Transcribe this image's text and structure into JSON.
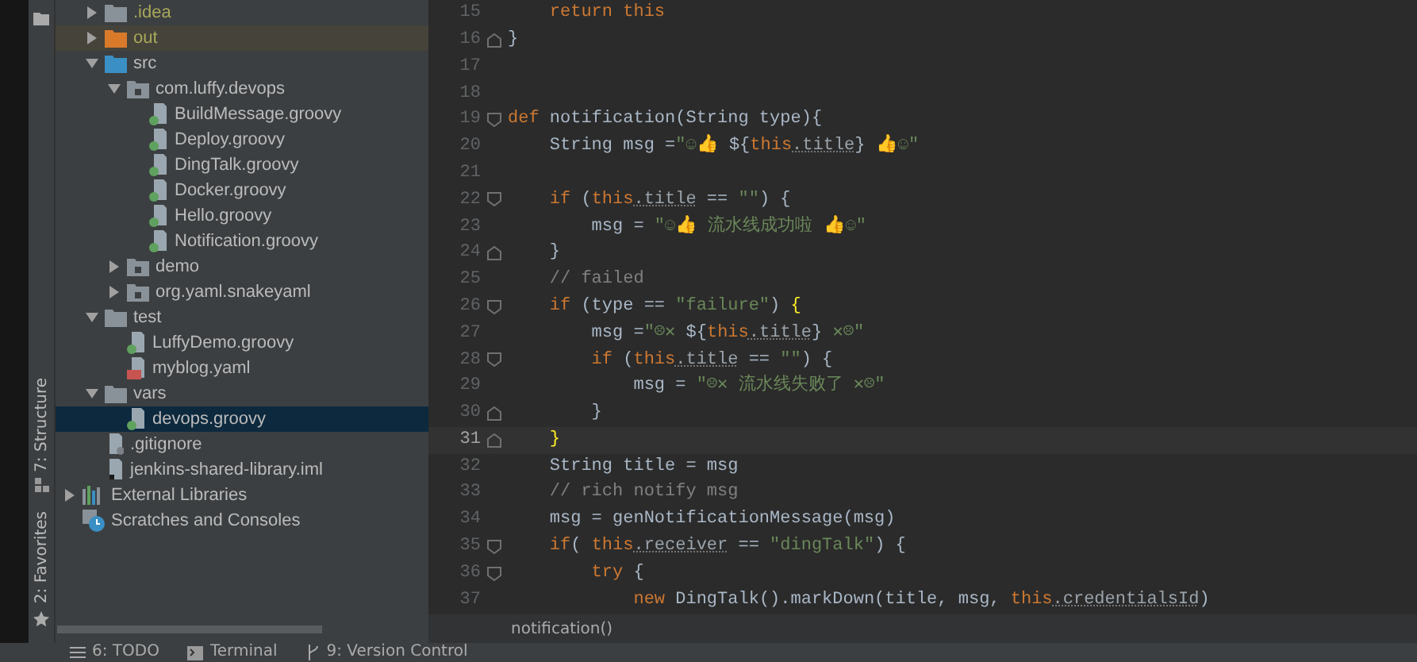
{
  "side_tabs": [
    {
      "label": "7: Structure",
      "kind": "structure"
    },
    {
      "label": "2: Favorites",
      "kind": "favorites"
    }
  ],
  "project_tree": {
    "project_children": [
      {
        "label": ".idea",
        "kind": "folder",
        "ignored": true,
        "expanded": false,
        "selected": false
      },
      {
        "label": "out",
        "kind": "excluded-folder",
        "ignored": true,
        "expanded": false,
        "selected": false
      },
      {
        "label": "src",
        "kind": "source-folder",
        "ignored": false,
        "expanded": true,
        "selected": false,
        "children": [
          {
            "label": "com.luffy.devops",
            "kind": "package",
            "ignored": false,
            "expanded": true,
            "selected": false,
            "children": [
              {
                "label": "BuildMessage.groovy",
                "kind": "groovy",
                "ignored": false,
                "selected": false
              },
              {
                "label": "Deploy.groovy",
                "kind": "groovy",
                "ignored": false,
                "selected": false
              },
              {
                "label": "DingTalk.groovy",
                "kind": "groovy",
                "ignored": false,
                "selected": false
              },
              {
                "label": "Docker.groovy",
                "kind": "groovy",
                "ignored": false,
                "selected": false
              },
              {
                "label": "Hello.groovy",
                "kind": "groovy",
                "ignored": false,
                "selected": false
              },
              {
                "label": "Notification.groovy",
                "kind": "groovy",
                "ignored": false,
                "selected": false
              }
            ]
          },
          {
            "label": "demo",
            "kind": "package",
            "ignored": false,
            "expanded": false,
            "selected": false
          },
          {
            "label": "org.yaml.snakeyaml",
            "kind": "package",
            "ignored": false,
            "expanded": false,
            "selected": false
          }
        ]
      },
      {
        "label": "test",
        "kind": "folder",
        "ignored": false,
        "expanded": true,
        "selected": false,
        "children": [
          {
            "label": "LuffyDemo.groovy",
            "kind": "groovy",
            "ignored": false,
            "selected": false
          },
          {
            "label": "myblog.yaml",
            "kind": "yaml",
            "ignored": false,
            "selected": false
          }
        ]
      },
      {
        "label": "vars",
        "kind": "folder",
        "ignored": false,
        "expanded": true,
        "selected": false,
        "children": [
          {
            "label": "devops.groovy",
            "kind": "groovy",
            "ignored": false,
            "selected": true
          }
        ]
      },
      {
        "label": ".gitignore",
        "kind": "gitignore",
        "ignored": false,
        "selected": false
      },
      {
        "label": "jenkins-shared-library.iml",
        "kind": "iml",
        "ignored": false,
        "selected": false
      }
    ],
    "items": [
      {
        "label": "External Libraries",
        "kind": "libraries",
        "ignored": false,
        "expanded": false,
        "selected": false
      },
      {
        "label": "Scratches and Consoles",
        "kind": "scratches",
        "ignored": false,
        "selected": false
      }
    ]
  },
  "editor": {
    "lines": [
      {
        "number": "15",
        "current": false,
        "kind": "plain",
        "tokens": [
          {
            "kind": "keyword",
            "text": "    return this"
          }
        ]
      },
      {
        "number": "16",
        "current": false,
        "kind": "fold-end",
        "tokens": [
          {
            "kind": "plain",
            "text": "}"
          }
        ]
      },
      {
        "number": "17",
        "current": false,
        "kind": "plain"
      },
      {
        "number": "18",
        "current": false,
        "kind": "plain"
      },
      {
        "number": "19",
        "current": false,
        "kind": "fold-start",
        "tokens": [
          {
            "kind": "keyword",
            "text": "def"
          },
          {
            "kind": "plain",
            "text": " notification(String type){"
          }
        ]
      },
      {
        "number": "20",
        "current": false,
        "kind": "plain",
        "tokens": [
          {
            "kind": "plain",
            "text": "    String msg ="
          },
          {
            "kind": "string",
            "text": "\"☺👍 "
          },
          {
            "kind": "plain",
            "text": "${"
          },
          {
            "kind": "keyword",
            "text": "this"
          },
          {
            "kind": "field",
            "text": ".title"
          },
          {
            "kind": "plain",
            "text": "}"
          },
          {
            "kind": "string",
            "text": " 👍☺\""
          }
        ]
      },
      {
        "number": "21",
        "current": false,
        "kind": "plain"
      },
      {
        "number": "22",
        "current": false,
        "kind": "fold-start",
        "tokens": [
          {
            "kind": "keyword",
            "text": "    if"
          },
          {
            "kind": "plain",
            "text": " ("
          },
          {
            "kind": "keyword",
            "text": "this"
          },
          {
            "kind": "field",
            "text": ".title"
          },
          {
            "kind": "plain",
            "text": " == "
          },
          {
            "kind": "string",
            "text": "\"\""
          },
          {
            "kind": "plain",
            "text": ") {"
          }
        ]
      },
      {
        "number": "23",
        "current": false,
        "kind": "plain",
        "tokens": [
          {
            "kind": "plain",
            "text": "        msg = "
          },
          {
            "kind": "string",
            "text": "\"☺👍 流水线成功啦 👍☺\""
          }
        ]
      },
      {
        "number": "24",
        "current": false,
        "kind": "fold-end",
        "tokens": [
          {
            "kind": "plain",
            "text": "    }"
          }
        ]
      },
      {
        "number": "25",
        "current": false,
        "kind": "plain",
        "tokens": [
          {
            "kind": "comment",
            "text": "    // failed"
          }
        ]
      },
      {
        "number": "26",
        "current": false,
        "kind": "fold-start",
        "tokens": [
          {
            "kind": "keyword",
            "text": "    if"
          },
          {
            "kind": "plain",
            "text": " (type == "
          },
          {
            "kind": "string",
            "text": "\"failure\""
          },
          {
            "kind": "plain",
            "text": ") "
          },
          {
            "kind": "match",
            "text": "{"
          }
        ]
      },
      {
        "number": "27",
        "current": false,
        "kind": "plain",
        "tokens": [
          {
            "kind": "plain",
            "text": "        msg ="
          },
          {
            "kind": "string",
            "text": "\"☹✕ "
          },
          {
            "kind": "plain",
            "text": "${"
          },
          {
            "kind": "keyword",
            "text": "this"
          },
          {
            "kind": "field",
            "text": ".title"
          },
          {
            "kind": "plain",
            "text": "}"
          },
          {
            "kind": "string",
            "text": " ✕☹\""
          }
        ]
      },
      {
        "number": "28",
        "current": false,
        "kind": "fold-start",
        "tokens": [
          {
            "kind": "keyword",
            "text": "        if"
          },
          {
            "kind": "plain",
            "text": " ("
          },
          {
            "kind": "keyword",
            "text": "this"
          },
          {
            "kind": "field",
            "text": ".title"
          },
          {
            "kind": "plain",
            "text": " == "
          },
          {
            "kind": "string",
            "text": "\"\""
          },
          {
            "kind": "plain",
            "text": ") {"
          }
        ]
      },
      {
        "number": "29",
        "current": false,
        "kind": "plain",
        "tokens": [
          {
            "kind": "plain",
            "text": "            msg = "
          },
          {
            "kind": "string",
            "text": "\"☹✕ 流水线失败了 ✕☹\""
          }
        ]
      },
      {
        "number": "30",
        "current": false,
        "kind": "fold-end",
        "tokens": [
          {
            "kind": "plain",
            "text": "        }"
          }
        ]
      },
      {
        "number": "31",
        "current": true,
        "kind": "fold-end",
        "tokens": [
          {
            "kind": "match",
            "text": "    }"
          }
        ]
      },
      {
        "number": "32",
        "current": false,
        "kind": "plain",
        "tokens": [
          {
            "kind": "plain",
            "text": "    String title = msg"
          }
        ]
      },
      {
        "number": "33",
        "current": false,
        "kind": "plain",
        "tokens": [
          {
            "kind": "comment",
            "text": "    // rich notify msg"
          }
        ]
      },
      {
        "number": "34",
        "current": false,
        "kind": "plain",
        "tokens": [
          {
            "kind": "plain",
            "text": "    msg = genNotificationMessage(msg)"
          }
        ]
      },
      {
        "number": "35",
        "current": false,
        "kind": "fold-start",
        "tokens": [
          {
            "kind": "keyword",
            "text": "    if"
          },
          {
            "kind": "plain",
            "text": "( "
          },
          {
            "kind": "keyword",
            "text": "this"
          },
          {
            "kind": "field",
            "text": ".receiver"
          },
          {
            "kind": "plain",
            "text": " == "
          },
          {
            "kind": "string",
            "text": "\"dingTalk\""
          },
          {
            "kind": "plain",
            "text": ") {"
          }
        ]
      },
      {
        "number": "36",
        "current": false,
        "kind": "fold-start",
        "tokens": [
          {
            "kind": "keyword",
            "text": "        try"
          },
          {
            "kind": "plain",
            "text": " {"
          }
        ]
      },
      {
        "number": "37",
        "current": false,
        "kind": "plain",
        "tokens": [
          {
            "kind": "keyword",
            "text": "            new"
          },
          {
            "kind": "plain",
            "text": " DingTalk().markDown(title, msg, "
          },
          {
            "kind": "keyword",
            "text": "this"
          },
          {
            "kind": "field",
            "text": ".credentialsId"
          },
          {
            "kind": "plain",
            "text": ")"
          }
        ]
      }
    ]
  },
  "breadcrumb": "notification()",
  "bottom_tabs": [
    {
      "label": "6: TODO",
      "kind": "todo"
    },
    {
      "label": "Terminal",
      "kind": "terminal"
    },
    {
      "label": "9: Version Control",
      "kind": "vcs"
    }
  ]
}
